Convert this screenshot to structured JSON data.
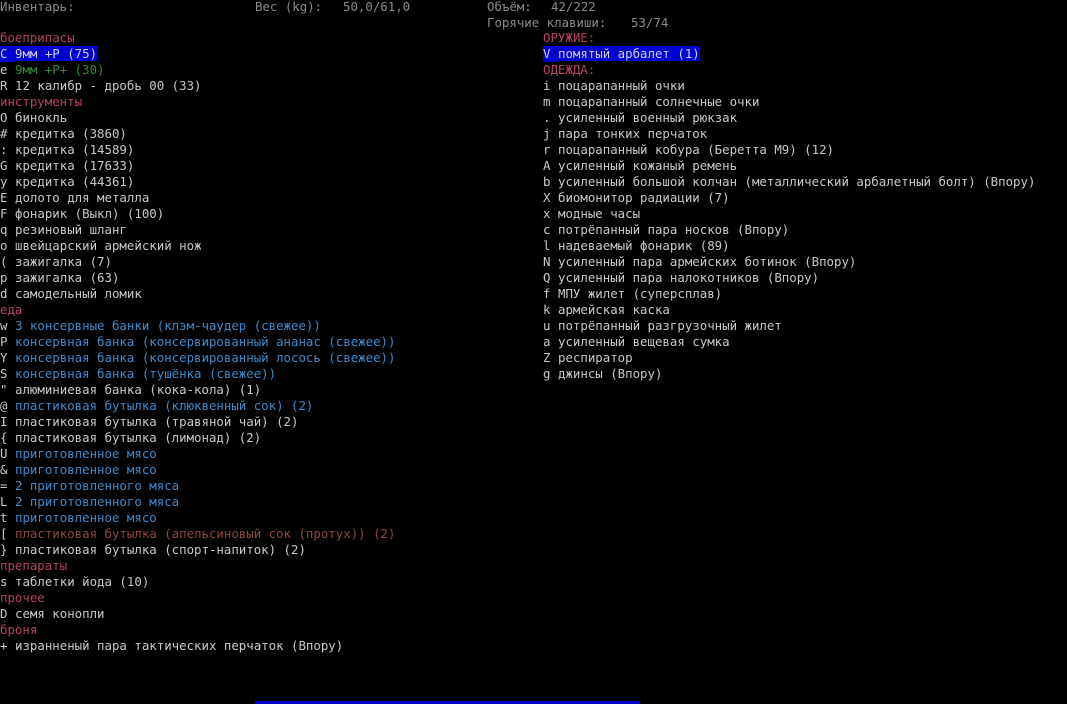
{
  "header": {
    "inventory_label": "Инвентарь:",
    "weight_label": "Вес (kg):",
    "weight_value": "50,0/61,0",
    "volume_label": "Объём:",
    "volume_value": "42/222",
    "hotkeys_label": "Горячие клавиши:",
    "hotkeys_value": "53/74"
  },
  "colors": {
    "category": "#b5455b",
    "selection": "#0000d0",
    "item_default": "#c8c8c8",
    "item_fresh": "#3e8ac8",
    "item_green": "#3a8a3a",
    "item_rotten": "#8a4a42"
  },
  "left_column": [
    {
      "type": "category",
      "label": "боеприпасы"
    },
    {
      "type": "item",
      "key": "C",
      "label": "9мм +P (75)",
      "style": "sel"
    },
    {
      "type": "item",
      "key": "e",
      "label": "9мм +P+ (30)",
      "style": "green"
    },
    {
      "type": "item",
      "key": "R",
      "label": "12 калибр - дробь 00 (33)",
      "style": "white"
    },
    {
      "type": "category",
      "label": "инструменты"
    },
    {
      "type": "item",
      "key": "O",
      "label": "бинокль",
      "style": "white"
    },
    {
      "type": "item",
      "key": "#",
      "label": "кредитка (3860)",
      "style": "white"
    },
    {
      "type": "item",
      "key": ":",
      "label": "кредитка (14589)",
      "style": "white"
    },
    {
      "type": "item",
      "key": "G",
      "label": "кредитка (17633)",
      "style": "white"
    },
    {
      "type": "item",
      "key": "y",
      "label": "кредитка (44361)",
      "style": "white"
    },
    {
      "type": "item",
      "key": "E",
      "label": "долото для металла",
      "style": "white"
    },
    {
      "type": "item",
      "key": "F",
      "label": "фонарик (Выкл) (100)",
      "style": "white"
    },
    {
      "type": "item",
      "key": "q",
      "label": "резиновый шланг",
      "style": "white"
    },
    {
      "type": "item",
      "key": "o",
      "label": "швейцарский армейский нож",
      "style": "white"
    },
    {
      "type": "item",
      "key": "(",
      "label": "зажигалка (7)",
      "style": "white"
    },
    {
      "type": "item",
      "key": "p",
      "label": "зажигалка (63)",
      "style": "white"
    },
    {
      "type": "item",
      "key": "d",
      "label": "самодельный ломик",
      "style": "white"
    },
    {
      "type": "category",
      "label": "еда"
    },
    {
      "type": "item",
      "key": "w",
      "label": "3 консервные банки (клэм-чаудер (свежее))",
      "style": "blue"
    },
    {
      "type": "item",
      "key": "P",
      "label": "консервная банка (консервированный ананас (свежее))",
      "style": "blue"
    },
    {
      "type": "item",
      "key": "Y",
      "label": "консервная банка (консервированный лосось (свежее))",
      "style": "blue"
    },
    {
      "type": "item",
      "key": "S",
      "label": "консервная банка (тушёнка (свежее))",
      "style": "blue"
    },
    {
      "type": "item",
      "key": "\"",
      "label": "алюминиевая банка (кока-кола) (1)",
      "style": "white"
    },
    {
      "type": "item",
      "key": "@",
      "label": "пластиковая бутылка (клюквенный сок) (2)",
      "style": "blue"
    },
    {
      "type": "item",
      "key": "I",
      "label": "пластиковая бутылка (травяной чай) (2)",
      "style": "white"
    },
    {
      "type": "item",
      "key": "{",
      "label": "пластиковая бутылка (лимонад) (2)",
      "style": "white"
    },
    {
      "type": "item",
      "key": "U",
      "label": "приготовленное мясо",
      "style": "blue"
    },
    {
      "type": "item",
      "key": "&",
      "label": "приготовленное мясо",
      "style": "blue"
    },
    {
      "type": "item",
      "key": "=",
      "label": "2 приготовленного мяса",
      "style": "blue"
    },
    {
      "type": "item",
      "key": "L",
      "label": "2 приготовленного мяса",
      "style": "blue"
    },
    {
      "type": "item",
      "key": "t",
      "label": "приготовленное мясо",
      "style": "blue"
    },
    {
      "type": "item",
      "key": "[",
      "label": "пластиковая бутылка (апельсиновый сок (протух)) (2)",
      "style": "brown"
    },
    {
      "type": "item",
      "key": "}",
      "label": "пластиковая бутылка (спорт-напиток) (2)",
      "style": "white"
    },
    {
      "type": "category",
      "label": "препараты"
    },
    {
      "type": "item",
      "key": "s",
      "label": "таблетки йода (10)",
      "style": "white"
    },
    {
      "type": "category",
      "label": "прочее"
    },
    {
      "type": "item",
      "key": "D",
      "label": "семя конопли",
      "style": "white"
    },
    {
      "type": "category",
      "label": "броня"
    },
    {
      "type": "item",
      "key": "+",
      "label": "изранненый пара тактических перчаток (Впору)",
      "style": "white"
    }
  ],
  "right_column": [
    {
      "type": "category",
      "label": "ОРУЖИЕ:"
    },
    {
      "type": "item",
      "key": "V",
      "label": "помятый арбалет (1)",
      "style": "sel"
    },
    {
      "type": "category",
      "label": "ОДЕЖДА:"
    },
    {
      "type": "item",
      "key": "i",
      "label": "поцарапанный очки",
      "style": "white"
    },
    {
      "type": "item",
      "key": "m",
      "label": "поцарапанный солнечные очки",
      "style": "white"
    },
    {
      "type": "item",
      "key": ".",
      "label": "усиленный военный рюкзак",
      "style": "white"
    },
    {
      "type": "item",
      "key": "j",
      "label": "пара тонких перчаток",
      "style": "white"
    },
    {
      "type": "item",
      "key": "r",
      "label": "поцарапанный кобура (Беретта М9) (12)",
      "style": "white"
    },
    {
      "type": "item",
      "key": "A",
      "label": "усиленный кожаный ремень",
      "style": "white"
    },
    {
      "type": "item",
      "key": "b",
      "label": "усиленный большой колчан (металлический арбалетный болт) (Впору)",
      "style": "white"
    },
    {
      "type": "item",
      "key": "X",
      "label": "биомонитор радиации (7)",
      "style": "white"
    },
    {
      "type": "item",
      "key": "x",
      "label": "модные часы",
      "style": "white"
    },
    {
      "type": "item",
      "key": "c",
      "label": "потрёпанный пара носков (Впору)",
      "style": "white"
    },
    {
      "type": "item",
      "key": "l",
      "label": "надеваемый фонарик (89)",
      "style": "white"
    },
    {
      "type": "item",
      "key": "N",
      "label": "усиленный пара армейских ботинок (Впору)",
      "style": "white"
    },
    {
      "type": "item",
      "key": "Q",
      "label": "усиленный пара налокотников (Впору)",
      "style": "white"
    },
    {
      "type": "item",
      "key": "f",
      "label": "МПУ жилет (суперсплав)",
      "style": "white"
    },
    {
      "type": "item",
      "key": "k",
      "label": "армейская каска",
      "style": "white"
    },
    {
      "type": "item",
      "key": "u",
      "label": "потрёпанный разгрузочный жилет",
      "style": "white"
    },
    {
      "type": "item",
      "key": "a",
      "label": "усиленный вещевая сумка",
      "style": "white"
    },
    {
      "type": "item",
      "key": "Z",
      "label": "респиратор",
      "style": "white"
    },
    {
      "type": "item",
      "key": "g",
      "label": "джинсы (Впору)",
      "style": "white"
    }
  ]
}
